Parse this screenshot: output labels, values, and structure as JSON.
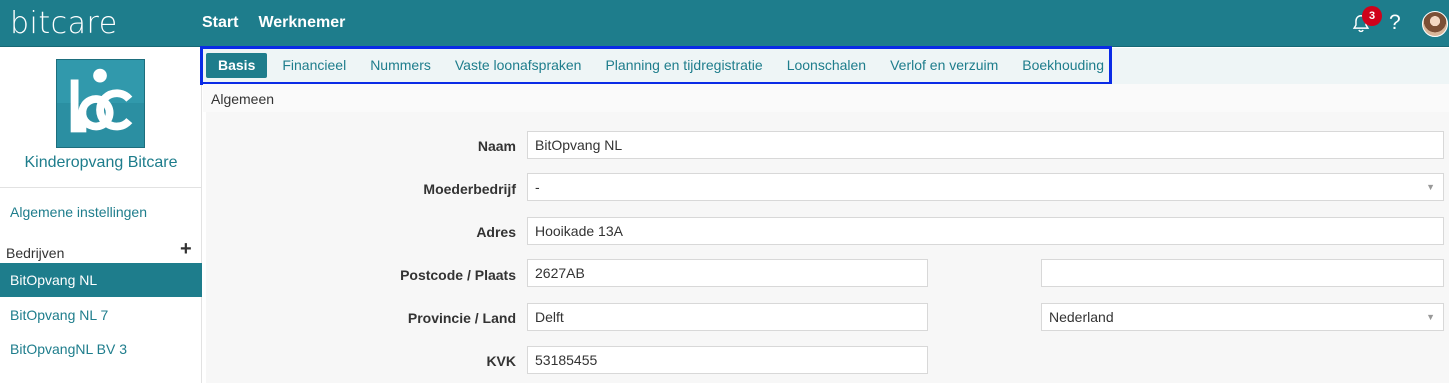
{
  "app": {
    "brand": "bitcare"
  },
  "topnav": {
    "start": "Start",
    "werknemer": "Werknemer"
  },
  "notifications": {
    "count": "3"
  },
  "help": {
    "label": "?"
  },
  "sidebar": {
    "company_name": "Kinderopvang Bitcare",
    "general_settings": "Algemene instellingen",
    "companies_label": "Bedrijven",
    "add_label": "+",
    "items": [
      {
        "label": "BitOpvang NL"
      },
      {
        "label": "BitOpvang NL 7"
      },
      {
        "label": "BitOpvangNL BV 3"
      }
    ]
  },
  "tabs": [
    {
      "label": "Basis"
    },
    {
      "label": "Financieel"
    },
    {
      "label": "Nummers"
    },
    {
      "label": "Vaste loonafspraken"
    },
    {
      "label": "Planning en tijdregistratie"
    },
    {
      "label": "Loonschalen"
    },
    {
      "label": "Verlof en verzuim"
    },
    {
      "label": "Boekhouding"
    }
  ],
  "section": {
    "title": "Algemeen"
  },
  "form": {
    "naam": {
      "label": "Naam",
      "value": "BitOpvang NL"
    },
    "moederbedrijf": {
      "label": "Moederbedrijf",
      "value": "-"
    },
    "adres": {
      "label": "Adres",
      "value": "Hooikade 13A"
    },
    "postcode_plaats": {
      "label": "Postcode / Plaats",
      "postcode": "2627AB",
      "plaats": ""
    },
    "provincie_land": {
      "label": "Provincie / Land",
      "provincie": "Delft",
      "land": "Nederland"
    },
    "kvk": {
      "label": "KVK",
      "value": "53185455"
    }
  },
  "colors": {
    "accent": "#1e7d8c",
    "highlight_frame": "#0a2be6",
    "badge": "#d0021b"
  }
}
